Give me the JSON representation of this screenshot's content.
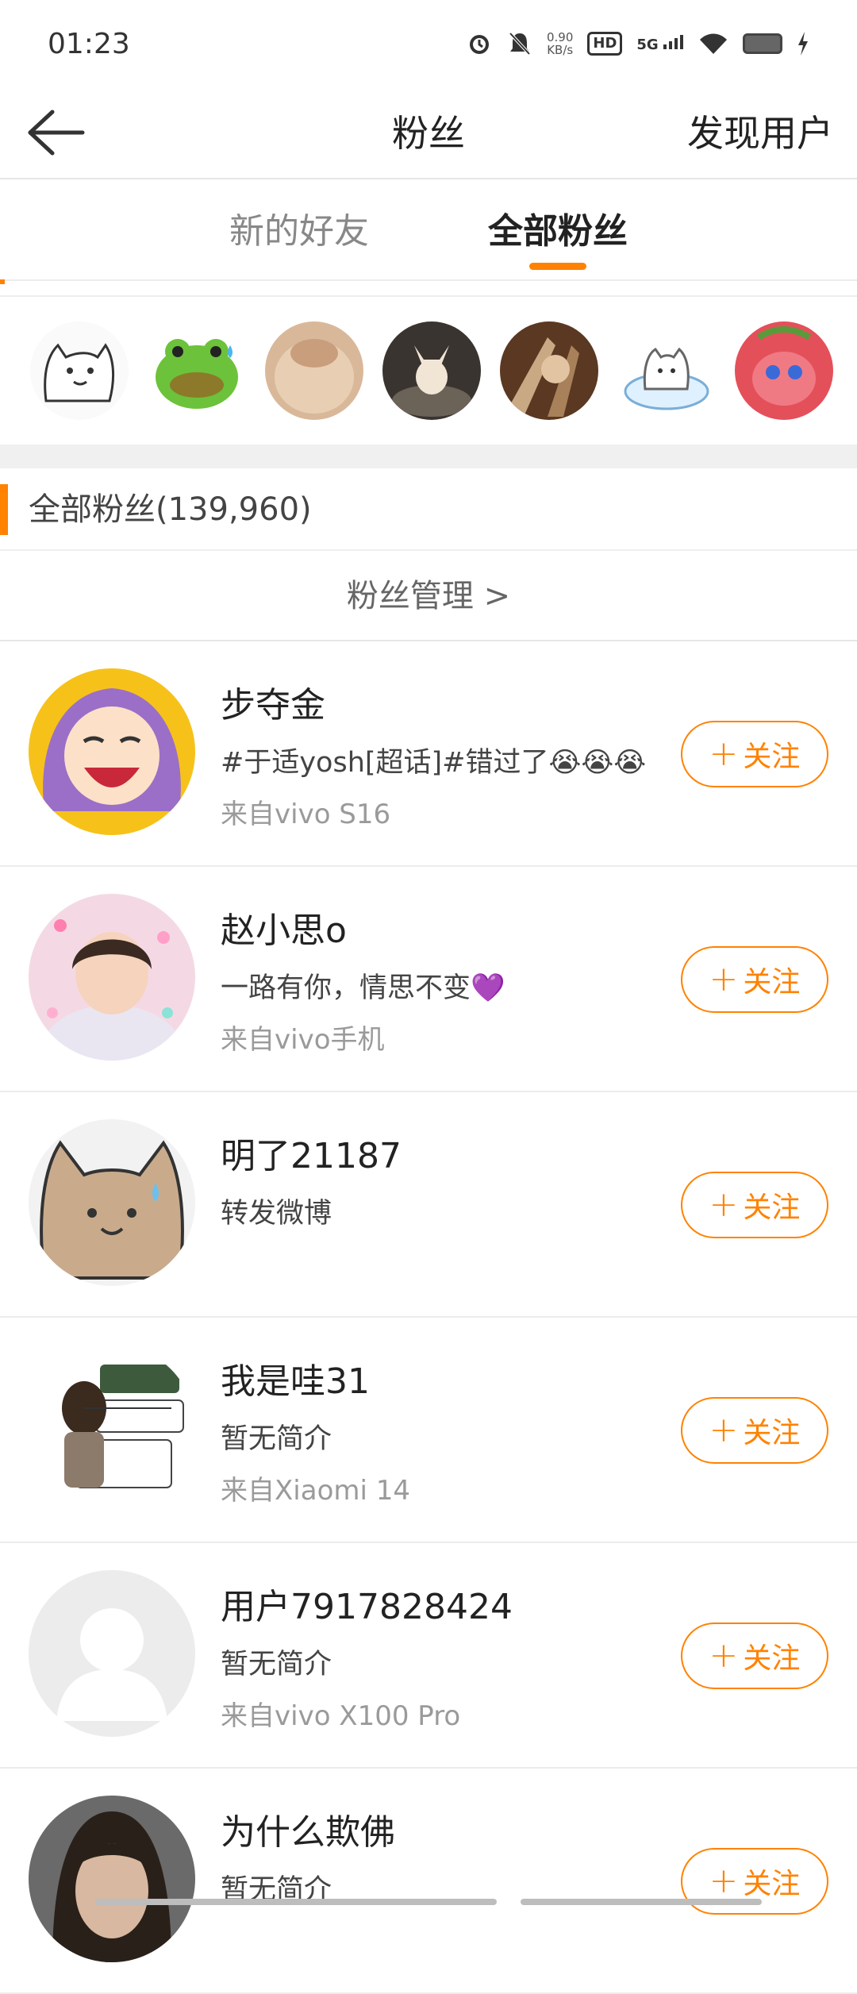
{
  "status_bar": {
    "time": "01:23",
    "net_speed_value": "0.90",
    "net_speed_unit": "KB/s",
    "hd": "HD",
    "network": "5G"
  },
  "header": {
    "title": "粉丝",
    "discover": "发现用户",
    "back_icon": "arrow-left-icon"
  },
  "tabs": [
    {
      "label": "新的好友",
      "active": false
    },
    {
      "label": "全部粉丝",
      "active": true
    }
  ],
  "section": {
    "label": "全部粉丝(139,960)",
    "manage": "粉丝管理  >"
  },
  "fans": [
    {
      "name": "步夺金",
      "bio": "#于适yosh[超话]#错过了😭😭😭",
      "source": "来自vivo S16",
      "follow": "关注"
    },
    {
      "name": "赵小思o",
      "bio": "一路有你，情思不变💜",
      "source": "来自vivo手机",
      "follow": "关注"
    },
    {
      "name": "明了21187",
      "bio": "转发微博",
      "source": "",
      "follow": "关注"
    },
    {
      "name": "我是哇31",
      "bio": "暂无简介",
      "source": "来自Xiaomi 14",
      "follow": "关注"
    },
    {
      "name": "用户7917828424",
      "bio": "暂无简介",
      "source": "来自vivo X100 Pro",
      "follow": "关注"
    },
    {
      "name": "为什么欺佛",
      "bio": "暂无简介",
      "source": "",
      "follow": "关注"
    }
  ],
  "colors": {
    "accent": "#ff8200"
  }
}
